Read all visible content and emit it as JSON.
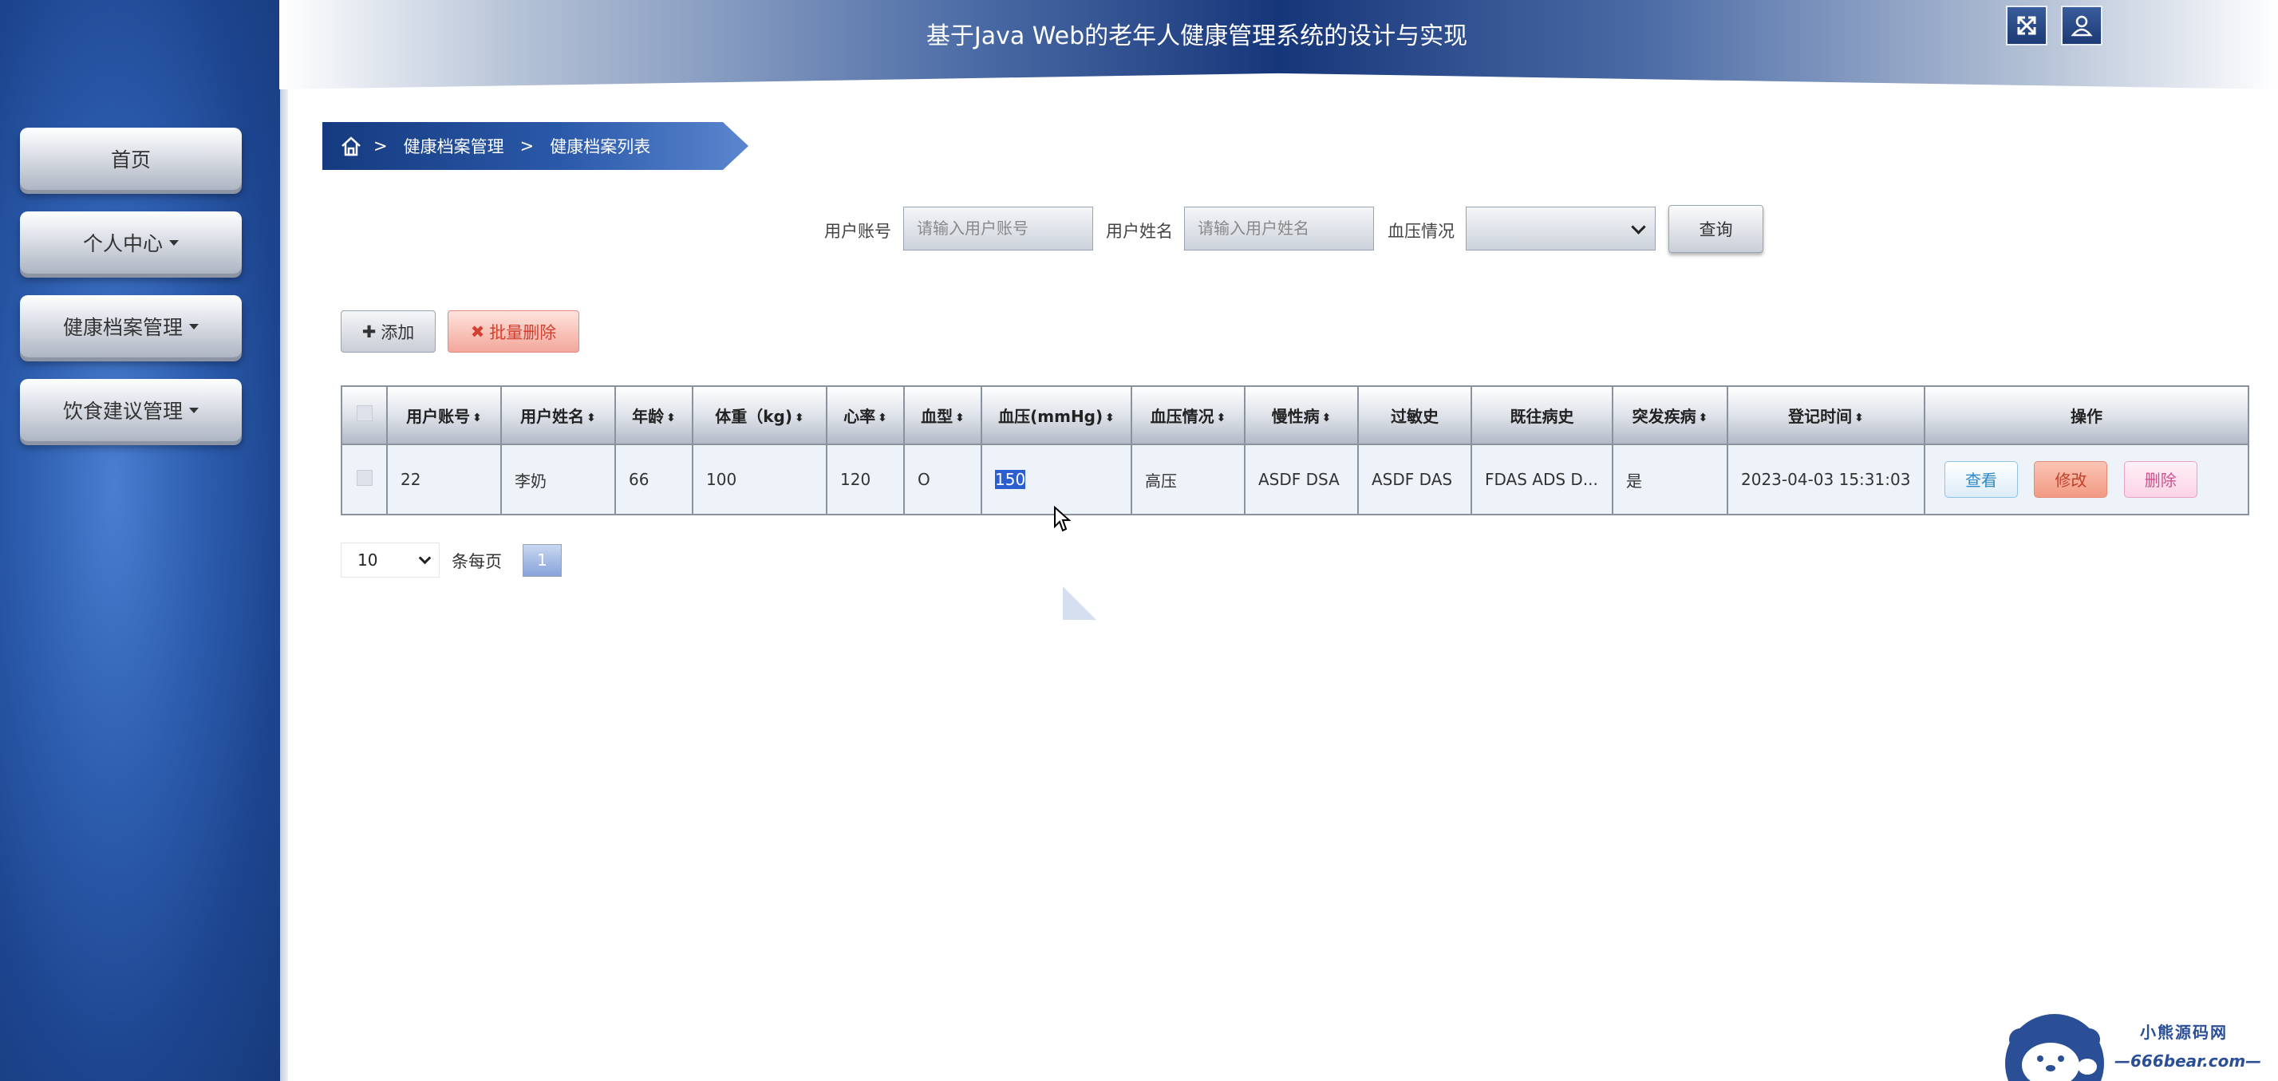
{
  "header": {
    "title": "基于Java Web的老年人健康管理系统的设计与实现"
  },
  "sidebar": {
    "items": [
      {
        "label": "首页"
      },
      {
        "label": "个人中心"
      },
      {
        "label": "健康档案管理"
      },
      {
        "label": "饮食建议管理"
      }
    ]
  },
  "breadcrumb": {
    "sep": ">",
    "level1": "健康档案管理",
    "level2": "健康档案列表"
  },
  "search": {
    "account_label": "用户账号",
    "account_placeholder": "请输入用户账号",
    "name_label": "用户姓名",
    "name_placeholder": "请输入用户姓名",
    "bp_label": "血压情况",
    "bp_value": "",
    "query_label": "查询"
  },
  "actions": {
    "add_label": "添加",
    "batch_delete_label": "批量删除"
  },
  "table": {
    "headers": [
      "用户账号",
      "用户姓名",
      "年龄",
      "体重（kg)",
      "心率",
      "血型",
      "血压(mmHg)",
      "血压情况",
      "慢性病",
      "过敏史",
      "既往病史",
      "突发疾病",
      "登记时间",
      "操作"
    ],
    "rows": [
      {
        "account": "22",
        "name": "李奶",
        "age": "66",
        "weight": "100",
        "heart_rate": "120",
        "blood_type": "O",
        "bp": "150",
        "bp_status": "高压",
        "chronic": "ASDF DSA",
        "allergy": "ASDF DAS",
        "history": "FDAS ADS D...",
        "sudden": "是",
        "time": "2023-04-03 15:31:03",
        "ops": {
          "view": "查看",
          "edit": "修改",
          "delete": "删除"
        }
      }
    ]
  },
  "pagination": {
    "page_size": "10",
    "per_page_label": "条每页",
    "current_page": "1"
  },
  "logo": {
    "text": "小熊源码网",
    "url": "—666bear.com—"
  },
  "colors": {
    "sidebar": "#2e5fb0",
    "header_center": "#16367a",
    "accent_delete": "#d24030"
  }
}
